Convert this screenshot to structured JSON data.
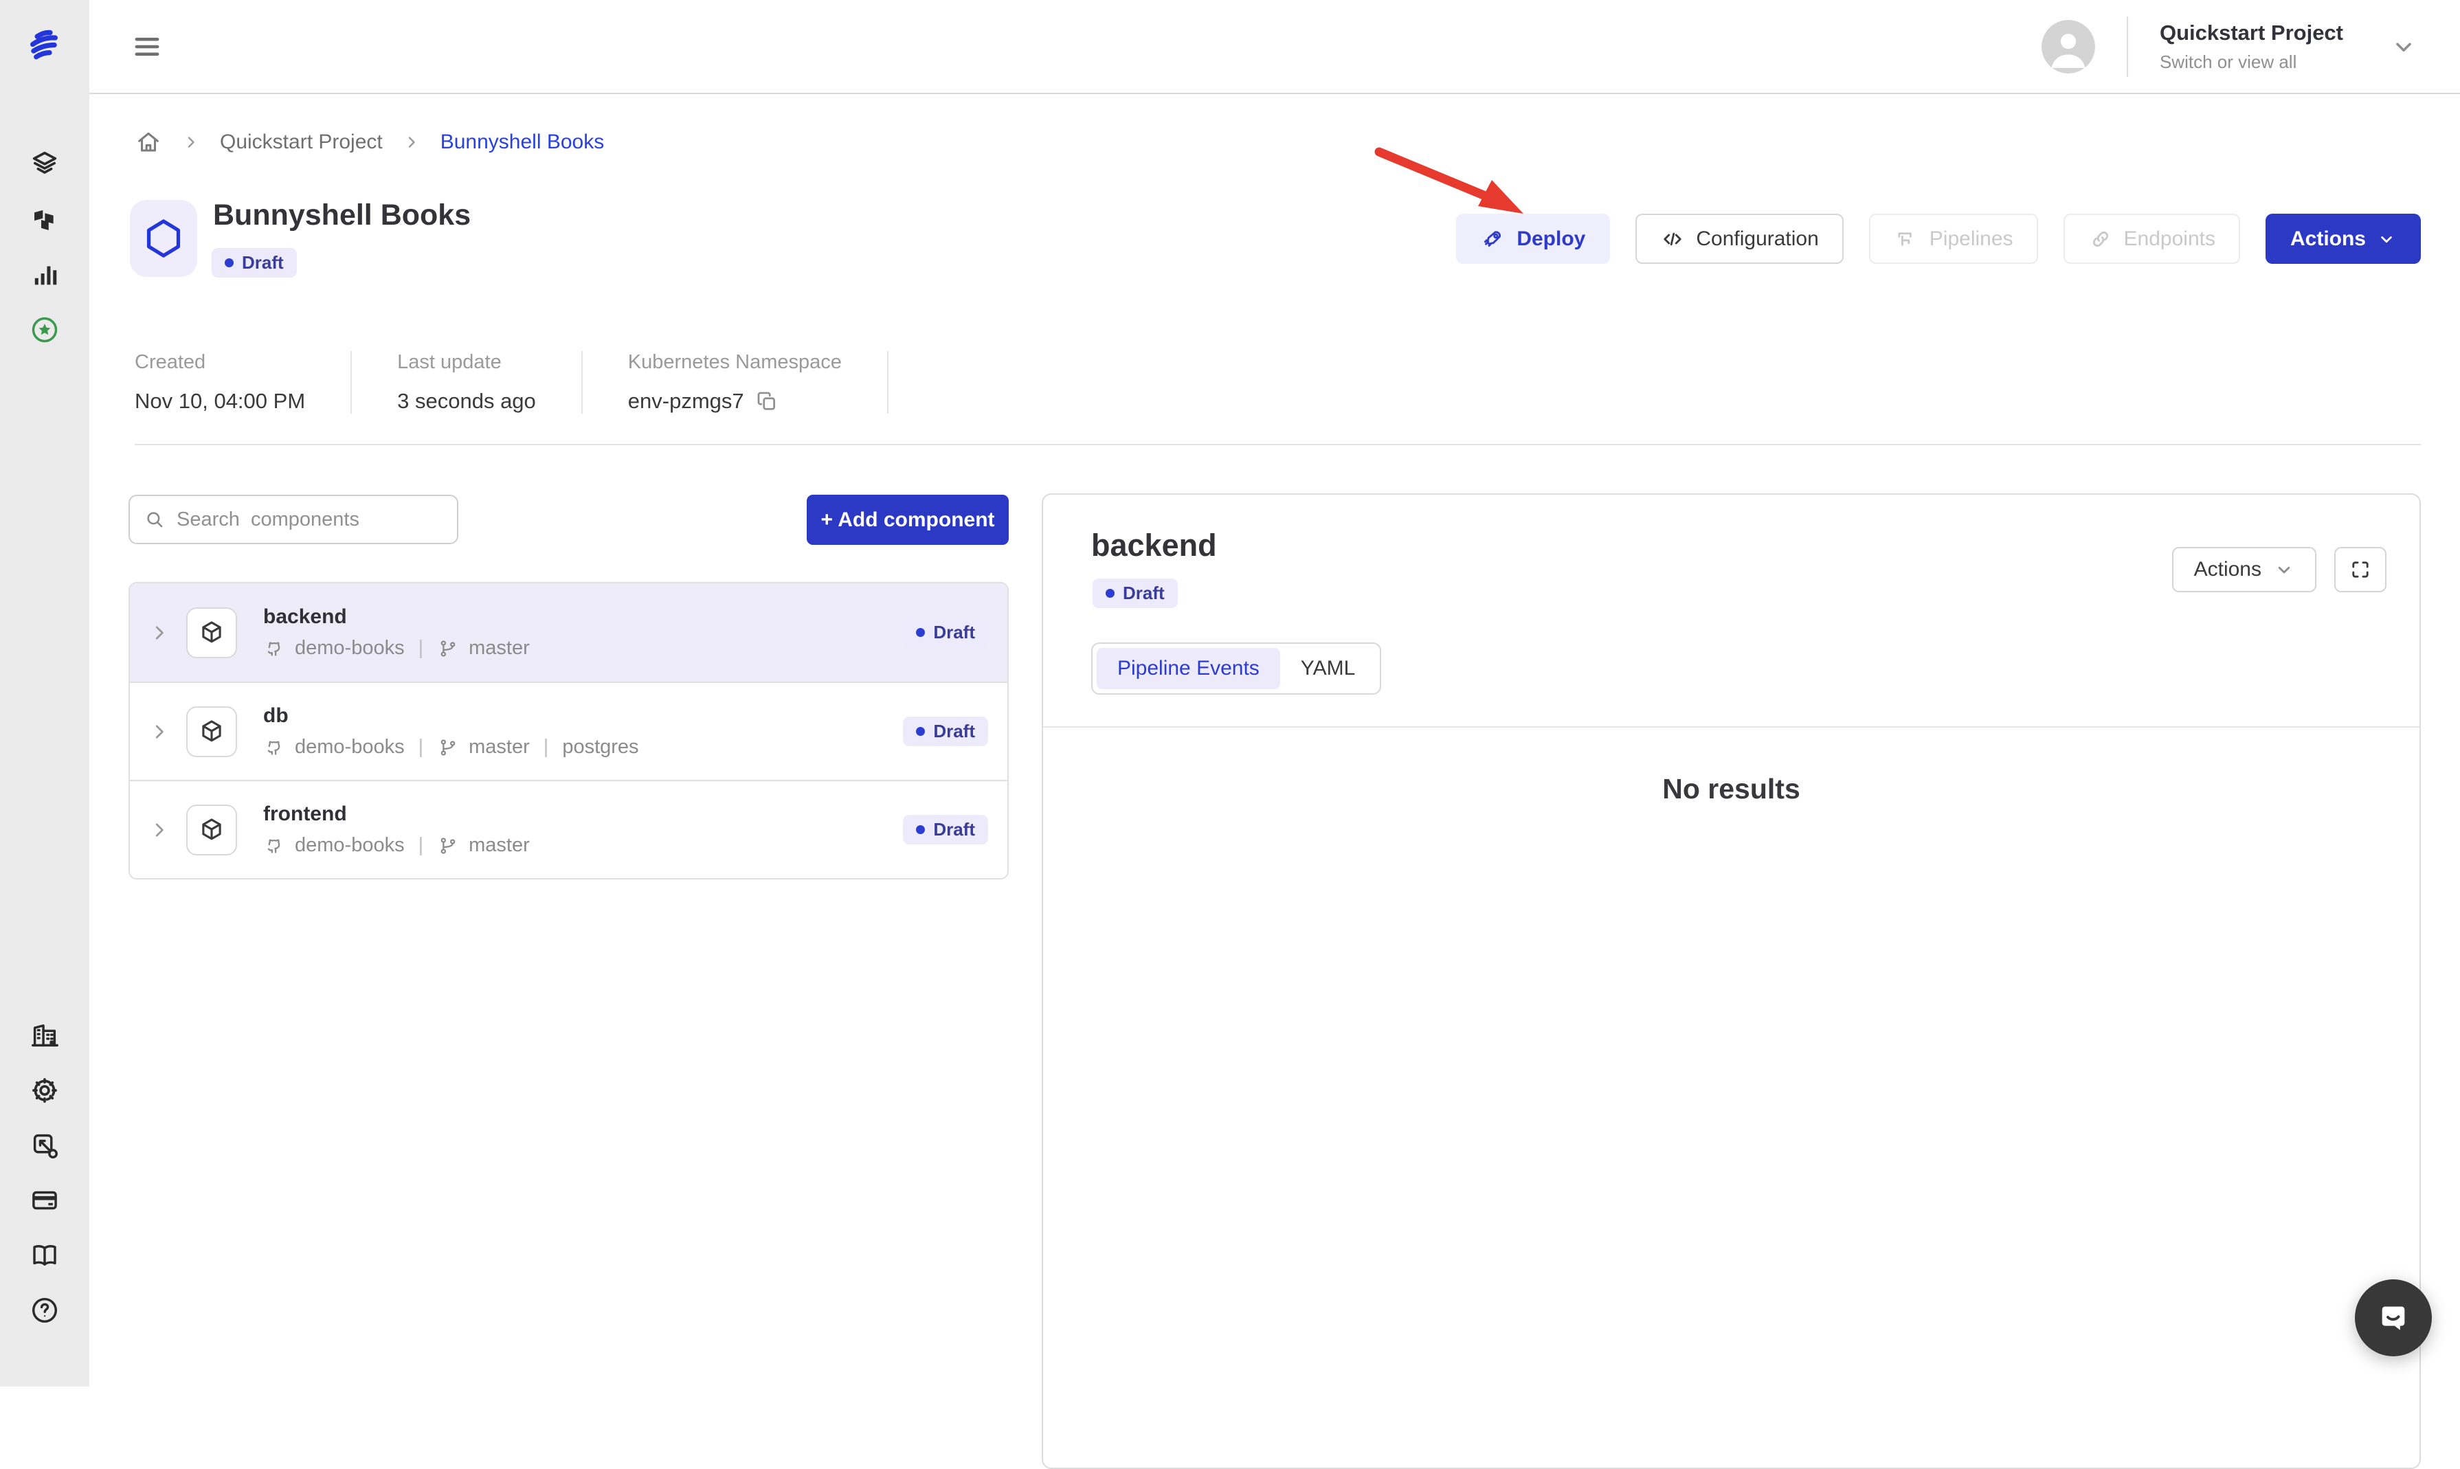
{
  "header": {
    "project": {
      "title": "Quickstart Project",
      "subtitle": "Switch or view all"
    }
  },
  "breadcrumb": {
    "project": "Quickstart Project",
    "current": "Bunnyshell Books"
  },
  "env": {
    "name": "Bunnyshell Books",
    "status": "Draft"
  },
  "toolbar": {
    "deploy": "Deploy",
    "configuration": "Configuration",
    "pipelines": "Pipelines",
    "endpoints": "Endpoints",
    "actions": "Actions"
  },
  "meta": {
    "created_label": "Created",
    "created_value": "Nov 10, 04:00 PM",
    "updated_label": "Last update",
    "updated_value": "3 seconds ago",
    "namespace_label": "Kubernetes Namespace",
    "namespace_value": "env-pzmgs7"
  },
  "components": {
    "search_placeholder": "Search  components",
    "add_button": "+ Add component",
    "items": [
      {
        "name": "backend",
        "repo": "demo-books",
        "branch": "master",
        "status": "Draft",
        "selected": true
      },
      {
        "name": "db",
        "repo": "demo-books",
        "branch": "master",
        "extra": "postgres",
        "status": "Draft",
        "selected": false
      },
      {
        "name": "frontend",
        "repo": "demo-books",
        "branch": "master",
        "status": "Draft",
        "selected": false
      }
    ]
  },
  "panel": {
    "title": "backend",
    "status": "Draft",
    "actions_label": "Actions",
    "tabs": [
      "Pipeline Events",
      "YAML"
    ],
    "active_tab": "Pipeline Events",
    "empty": "No results"
  },
  "icons": {
    "sidebar_top": [
      "layers",
      "terraform",
      "bar-chart",
      "star-circle"
    ],
    "sidebar_bottom": [
      "organization",
      "settings",
      "export",
      "billing-card",
      "book",
      "help"
    ],
    "annotation": "red-arrow-pointing-at-deploy"
  },
  "colors": {
    "primary_blue": "#2c39c4",
    "link_blue": "#2742e0",
    "deploy_bg": "#efeefc",
    "badge_bg": "#eceafb",
    "badge_dot": "#2c3dd1",
    "selected_row_bg": "#efecfa",
    "rail_bg": "#ebebeb",
    "star_green": "#3c9a4e",
    "arrow_red": "#e63a2e",
    "chat_bg": "#383838"
  }
}
